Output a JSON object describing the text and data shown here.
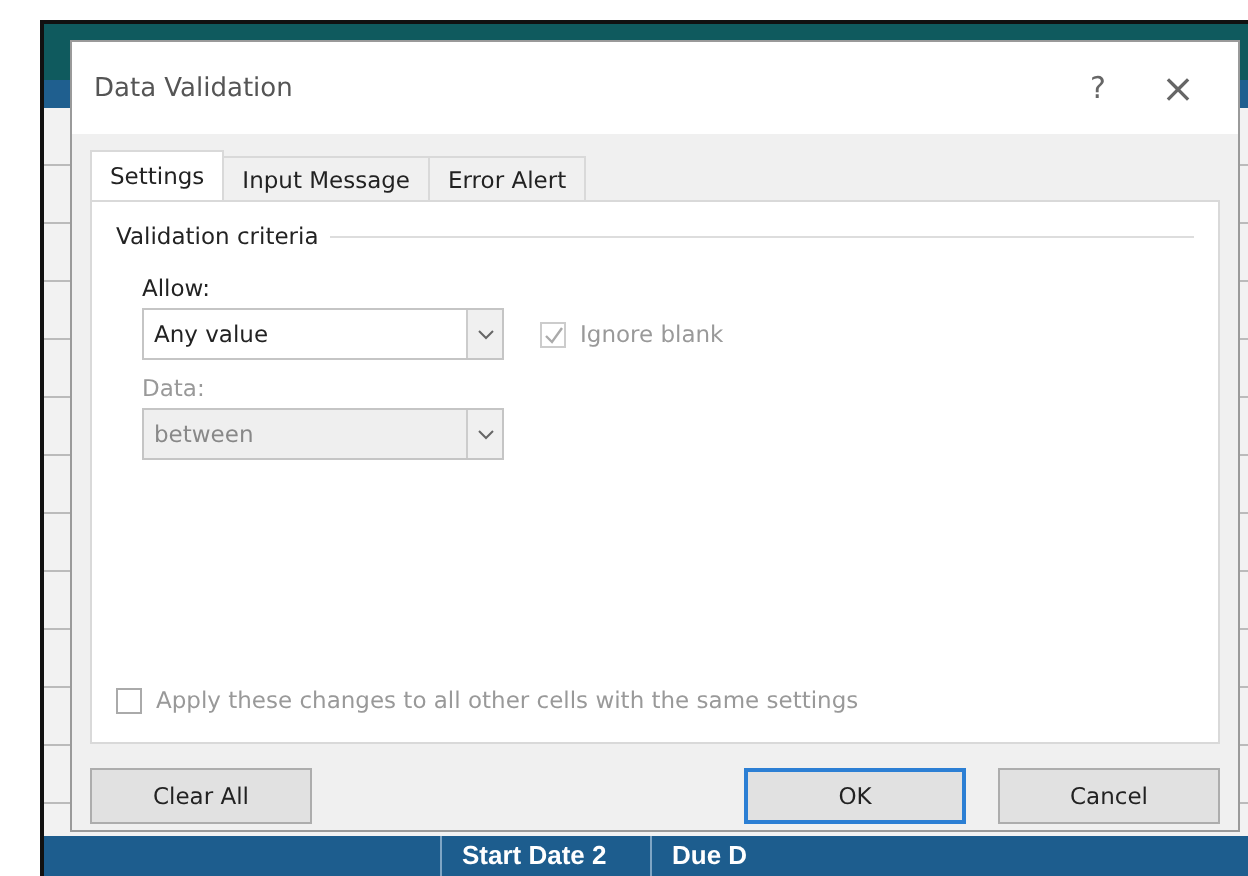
{
  "window": {
    "title": "Data Validation",
    "help": "?",
    "close": "×"
  },
  "tabs": [
    {
      "label": "Settings",
      "selected": true
    },
    {
      "label": "Input Message",
      "selected": false
    },
    {
      "label": "Error Alert",
      "selected": false
    }
  ],
  "criteria": {
    "heading": "Validation criteria",
    "allow": {
      "label": "Allow:",
      "value": "Any value",
      "disabled": false
    },
    "ignore_blank": {
      "label": "Ignore blank",
      "checked": true,
      "disabled": true
    },
    "data": {
      "label": "Data:",
      "value": "between",
      "disabled": true
    }
  },
  "apply_all": {
    "label": "Apply these changes to all other cells with the same settings",
    "checked": false
  },
  "buttons": [
    {
      "label": "Clear All",
      "kind": "left",
      "default": false
    },
    {
      "label": "OK",
      "kind": "right",
      "default": true
    },
    {
      "label": "Cancel",
      "kind": "right",
      "default": false
    }
  ],
  "sheet": {
    "headers": [
      "Start Date 2",
      "Due D"
    ]
  }
}
